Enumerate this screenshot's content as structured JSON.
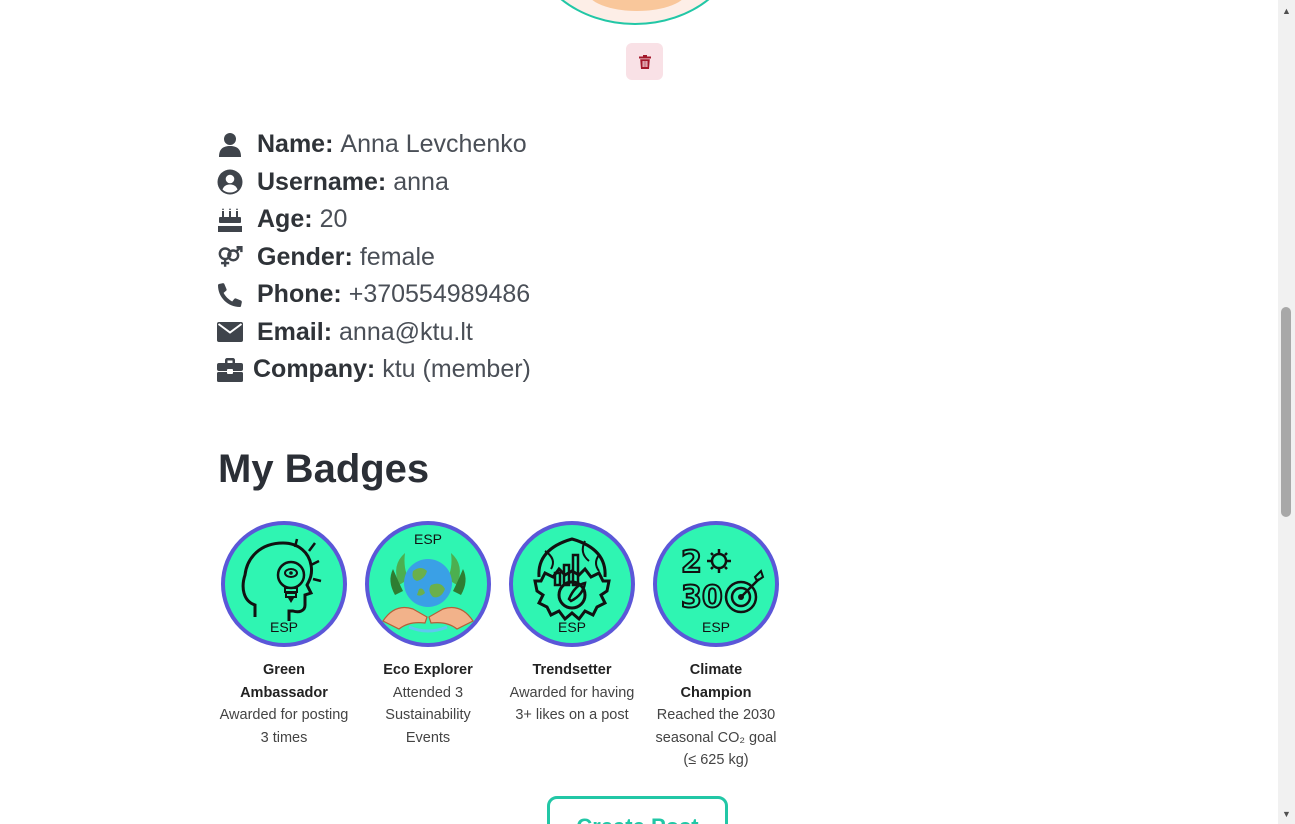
{
  "profile": {
    "rows": [
      {
        "icon": "user-icon",
        "label": "Name:",
        "value": "Anna Levchenko"
      },
      {
        "icon": "user-circle-icon",
        "label": "Username:",
        "value": "anna"
      },
      {
        "icon": "birthday-cake-icon",
        "label": "Age:",
        "value": "20"
      },
      {
        "icon": "gender-icon",
        "label": "Gender:",
        "value": "female"
      },
      {
        "icon": "phone-icon",
        "label": "Phone:",
        "value": "+370554989486"
      },
      {
        "icon": "envelope-icon",
        "label": "Email:",
        "value": "anna@ktu.lt"
      },
      {
        "icon": "briefcase-icon",
        "label": "Company:",
        "value": "ktu (member)"
      }
    ]
  },
  "badges": {
    "title": "My Badges",
    "items": [
      {
        "name": "Green Ambassador",
        "description": "Awarded for posting 3 times",
        "mark": "ESP",
        "icon": "lightbulb-head-icon"
      },
      {
        "name": "Eco Explorer",
        "description": "Attended 3 Sustainability Events",
        "mark": "ESP",
        "icon": "earth-in-hands-icon"
      },
      {
        "name": "Trendsetter",
        "description": "Awarded for having 3+ likes on a post",
        "mark": "ESP",
        "icon": "gear-chart-icon"
      },
      {
        "name": "Climate Champion",
        "description": "Reached the 2030 seasonal CO₂ goal (≤ 625 kg)",
        "mark": "ESP",
        "icon": "target-2030-icon"
      }
    ]
  },
  "actions": {
    "create_post_label": "Create Post"
  },
  "colors": {
    "accent": "#22c7a6",
    "badge_fill": "#2ff5b2",
    "badge_ring": "#5b57d8",
    "delete_bg": "#f9e1e6",
    "delete_icon": "#a3172a"
  }
}
